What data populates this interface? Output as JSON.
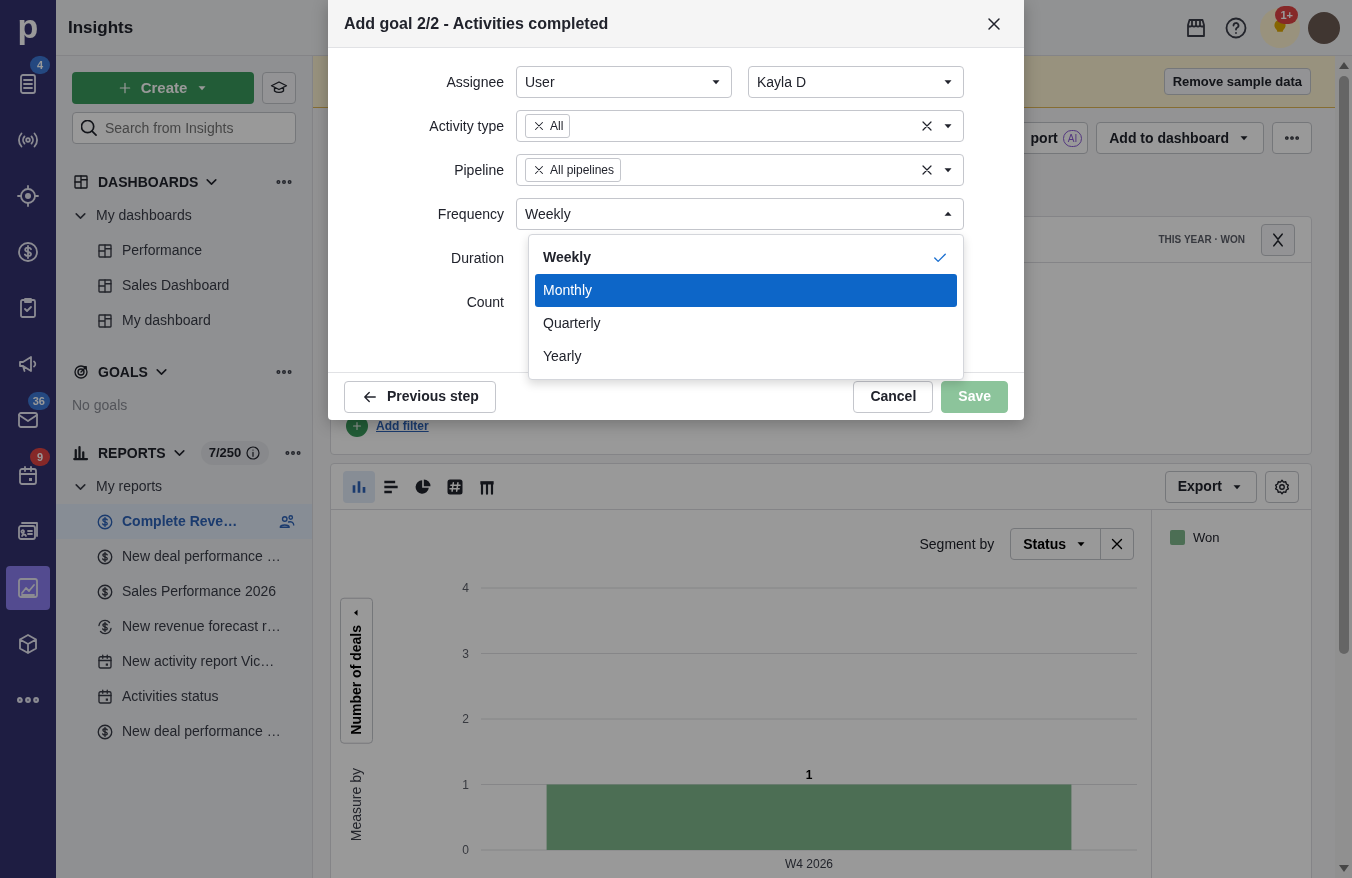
{
  "rail": {
    "logo": "p",
    "items": [
      {
        "badge": "4",
        "selected": false
      },
      {
        "selected": false
      },
      {
        "selected": false
      },
      {
        "selected": false
      },
      {
        "selected": false
      },
      {
        "selected": false
      },
      {
        "badge": "36",
        "selected": false
      },
      {
        "badge": "9",
        "selected": false
      },
      {
        "selected": false
      },
      {
        "selected": true
      },
      {
        "selected": false
      },
      {
        "selected": false
      }
    ]
  },
  "header": {
    "title": "Insights",
    "notification_badge": "1+"
  },
  "sidebar": {
    "create": "Create",
    "search": {
      "placeholder": "Search from Insights"
    },
    "dashboards": {
      "title": "DASHBOARDS",
      "group": "My dashboards",
      "expanded": true,
      "items": [
        "Performance",
        "Sales Dashboard",
        "My dashboard"
      ]
    },
    "goals": {
      "title": "GOALS",
      "empty": "No goals"
    },
    "reports": {
      "title": "REPORTS",
      "count": "7/250",
      "group": "My reports",
      "expanded": true,
      "items": [
        {
          "label": "Complete Reve…",
          "kind": "deal",
          "selected": true,
          "shared": true
        },
        {
          "label": "New deal performance …",
          "kind": "deal",
          "selected": false,
          "shared": false
        },
        {
          "label": "Sales Performance 2026",
          "kind": "deal",
          "selected": false,
          "shared": false
        },
        {
          "label": "New revenue forecast r…",
          "kind": "forecast",
          "selected": false,
          "shared": false
        },
        {
          "label": "New activity report Vic…",
          "kind": "activity",
          "selected": false,
          "shared": false
        },
        {
          "label": "Activities status",
          "kind": "activity",
          "selected": false,
          "shared": false
        },
        {
          "label": "New deal performance …",
          "kind": "deal",
          "selected": false,
          "shared": false
        }
      ]
    }
  },
  "banner": {
    "button": "Remove sample data"
  },
  "toolbar": {
    "partial_button": "port",
    "ai_badge": "AI",
    "add_to_dashboard": "Add to dashboard"
  },
  "filters": {
    "summary": "THIS YEAR · WON",
    "add_filter": "Add filter"
  },
  "chart_card": {
    "view_types": [
      {
        "selected": true
      },
      {
        "selected": false
      },
      {
        "selected": false
      },
      {
        "selected": false
      },
      {
        "selected": false
      }
    ],
    "export": "Export",
    "segment_label": "Segment by",
    "segment_value": "Status",
    "measure_label": "Measure by",
    "measure_value": "Number of deals",
    "chart_data": {
      "type": "bar",
      "categories": [
        "W4 2026"
      ],
      "series": [
        {
          "name": "Won",
          "color": "#4c6e54",
          "values": [
            1
          ]
        }
      ],
      "ylim": [
        0,
        4
      ],
      "yticks": [
        0,
        1,
        2,
        3,
        4
      ],
      "grid": true,
      "data_labels": true
    }
  },
  "modal": {
    "title": "Add goal 2/2 - Activities completed",
    "fields": [
      {
        "label": "Assignee",
        "kind": "double",
        "values": [
          "User",
          "Kayla D"
        ]
      },
      {
        "label": "Activity type",
        "kind": "tags",
        "tags": [
          "All"
        ]
      },
      {
        "label": "Pipeline",
        "kind": "tags",
        "tags": [
          "All pipelines"
        ]
      },
      {
        "label": "Frequency",
        "kind": "select",
        "value": "Weekly",
        "expanded": true
      },
      {
        "label": "Duration",
        "kind": "covered"
      },
      {
        "label": "Count",
        "kind": "covered"
      }
    ],
    "options": [
      {
        "label": "Weekly",
        "selected": true,
        "highlighted": false
      },
      {
        "label": "Monthly",
        "selected": false,
        "highlighted": true
      },
      {
        "label": "Quarterly",
        "selected": false,
        "highlighted": false
      },
      {
        "label": "Yearly",
        "selected": false,
        "highlighted": false
      }
    ],
    "previous": "Previous step",
    "cancel": "Cancel",
    "save": "Save",
    "save_disabled": true
  }
}
